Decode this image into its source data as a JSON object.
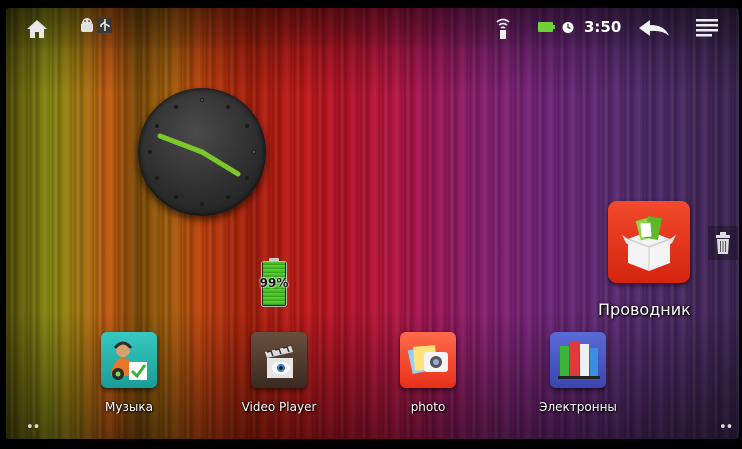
{
  "status_bar": {
    "time": "3:50",
    "icons": [
      "home-icon",
      "android-debug-icon",
      "usb-icon",
      "wifi-icon",
      "battery-icon",
      "alarm-icon",
      "back-icon",
      "menu-icon"
    ],
    "accent": "#6fd23a"
  },
  "widgets": {
    "battery_percent": "99%",
    "battery_level": 0.99,
    "clock": {
      "hour_hand": "3:50"
    }
  },
  "explorer": {
    "label": "Проводник",
    "icon": "explorer-box-icon"
  },
  "dock": {
    "apps": [
      {
        "label": "Музыка",
        "icon": "music-icon"
      },
      {
        "label": "Video Player",
        "icon": "video-player-icon"
      },
      {
        "label": "photo",
        "icon": "photo-icon"
      },
      {
        "label": "Электронны",
        "icon": "ebooks-icon"
      }
    ]
  },
  "page_indicators": {
    "left": "••",
    "right": "••"
  }
}
